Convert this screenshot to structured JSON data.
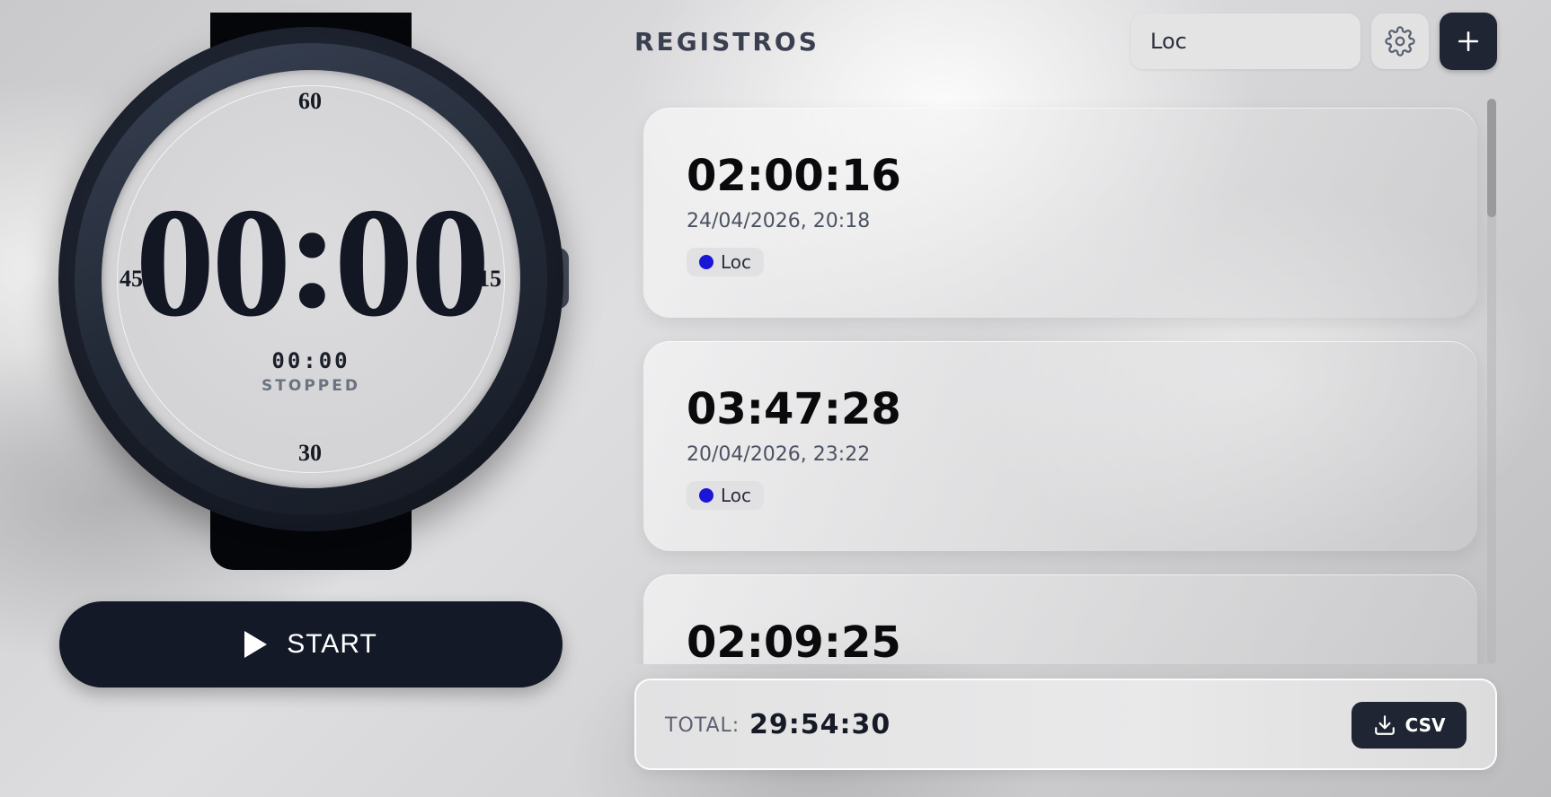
{
  "watch": {
    "ticks": {
      "top": "60",
      "right": "15",
      "bottom": "30",
      "left": "45"
    },
    "big_minutes": "00",
    "big_colon": ":",
    "big_seconds": "00",
    "small_time": "00:00",
    "status": "STOPPED"
  },
  "controls": {
    "start_label": "START",
    "icon": "play-icon"
  },
  "header": {
    "title": "REGISTROS",
    "search_value": "Loc",
    "settings_icon": "gear-icon",
    "add_icon": "plus-icon"
  },
  "records": [
    {
      "duration": "02:00:16",
      "date": "24/04/2026, 20:18",
      "tag": "Loc",
      "tag_color": "#1a16d6"
    },
    {
      "duration": "03:47:28",
      "date": "20/04/2026, 23:22",
      "tag": "Loc",
      "tag_color": "#1a16d6"
    },
    {
      "duration": "02:09:25",
      "date": "",
      "tag": "",
      "tag_color": "#1a16d6"
    }
  ],
  "footer": {
    "total_label": "TOTAL:",
    "total_value": "29:54:30",
    "csv_label": "CSV",
    "csv_icon": "download-icon"
  },
  "colors": {
    "primary_dark": "#131927",
    "accent_tag": "#1a16d6"
  }
}
